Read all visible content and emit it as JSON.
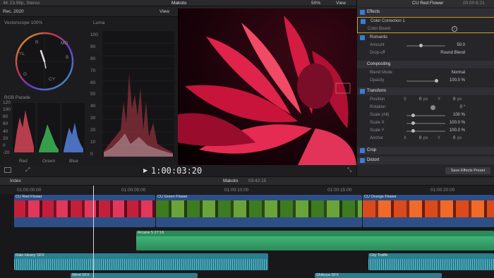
{
  "topbar": {
    "format": "4K 23.98p, Stereo",
    "viewer_title": "Makoto",
    "zoom": "50%",
    "view_label": "View",
    "inspector_clip": "CU Red Flower",
    "inspector_time": "00:00:6:21"
  },
  "scopes": {
    "clip_title": "Rec. 2020",
    "view_label": "View",
    "vectorscope_title": "Vectorscope 100%",
    "luma_title": "Luma",
    "luma_ticks": [
      "100",
      "90",
      "80",
      "70",
      "60",
      "50",
      "40",
      "30",
      "20",
      "10",
      "0"
    ],
    "rgb_title": "RGB Parade",
    "rgb_ticks": [
      "120",
      "100",
      "80",
      "60",
      "40",
      "20",
      "0",
      "-20"
    ],
    "rgb_channels": [
      "Red",
      "Green",
      "Blue"
    ],
    "vector_labels": [
      "R",
      "MG",
      "B",
      "CY",
      "G",
      "YL"
    ]
  },
  "transport": {
    "timecode": "1:00:03:20"
  },
  "inspector": {
    "effects_header": "Effects",
    "color_correction": "Color Correction 1",
    "color_board": "Color Board",
    "romantic": "Romantic",
    "amount_label": "Amount",
    "amount_value": "50.0",
    "dropoff_label": "Drop-off",
    "dropoff_value": "Round Blend",
    "compositing_header": "Compositing",
    "blend_label": "Blend Mode",
    "blend_value": "Normal",
    "opacity_label": "Opacity",
    "opacity_value": "100.0 %",
    "transform_header": "Transform",
    "position_label": "Position",
    "position_x": "0",
    "position_y": "0",
    "px": "px",
    "x_label": "X",
    "y_label": "Y",
    "rotation_label": "Rotation",
    "rotation_value": "0 °",
    "scale_all_label": "Scale (All)",
    "scale_all_value": "100 %",
    "scale_x_label": "Scale X",
    "scale_x_value": "100.0 %",
    "scale_y_label": "Scale Y",
    "scale_y_value": "100.0 %",
    "anchor_label": "Anchor",
    "anchor_x": "0",
    "anchor_y": "0",
    "crop_header": "Crop",
    "distort_header": "Distort",
    "save_preset": "Save Effects Preset"
  },
  "timeline_bar": {
    "index": "Index",
    "project": "Makoto",
    "duration": "03:42:15"
  },
  "ruler": {
    "ticks": [
      "01:00:00:00",
      "01:00:05:00",
      "01:00:10:00",
      "01:00:15:00",
      "01:00:20:00"
    ]
  },
  "clips": {
    "red": "CU Red Flower",
    "green": "CU Green Flower",
    "orange": "CU Orange Flower",
    "music": "Arcane 5 27:16",
    "rain": "Rain Heavy SFX",
    "city": "City Traffic",
    "wind": "Wind SFX",
    "shibuya": "Shibuya SFX"
  },
  "colors": {
    "accent": "#3b7bd8",
    "video_clip": "#2d4f86",
    "audio_green": "#2c8a5a",
    "audio_teal": "#2a7e8f",
    "playhead": "#d8d8e0"
  }
}
